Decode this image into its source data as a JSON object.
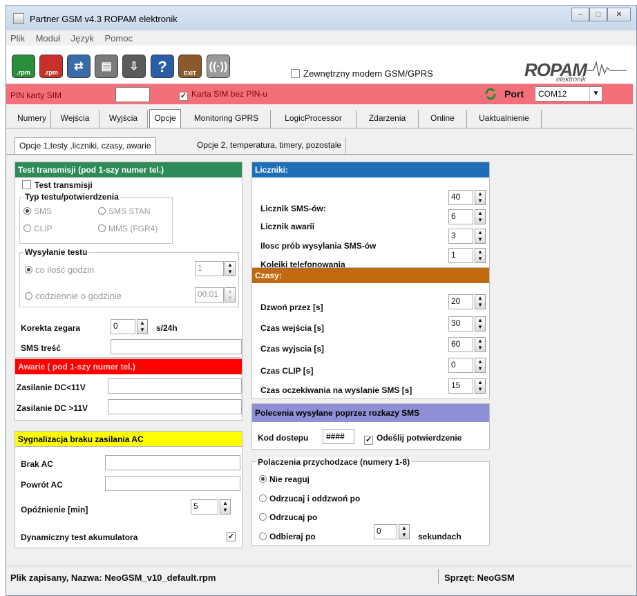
{
  "window": {
    "title": "Partner GSM v4.3 ROPAM elektronik",
    "controls": {
      "minimize": "−",
      "maximize": "□",
      "close": "✕"
    }
  },
  "menu": [
    "Plik",
    "Moduł",
    "Język",
    "Pomoc"
  ],
  "toolbar": {
    "buttons": [
      {
        "icon": "open-rpm-icon",
        "label": ".rpm",
        "color": "#2a8f3a"
      },
      {
        "icon": "save-rpm-icon",
        "label": ".rpm",
        "color": "#c8302a"
      },
      {
        "icon": "read-module-icon",
        "label": "",
        "color": "#3a6aa8"
      },
      {
        "icon": "module-icon",
        "label": "",
        "color": "#7a7a7a"
      },
      {
        "icon": "write-module-icon",
        "label": "",
        "color": "#5a5a5a"
      },
      {
        "icon": "help-icon",
        "label": "?",
        "color": "#2a5da8"
      },
      {
        "icon": "exit-icon",
        "label": "EXIT",
        "color": "#8a5a2a"
      },
      {
        "icon": "wireless-icon",
        "label": "",
        "color": "#9a9a9a"
      }
    ],
    "external_modem_label": "Zewnętrzny modem GSM/GPRS",
    "external_modem_checked": false,
    "logo_text": "ROPAM",
    "logo_sub": "elektronik"
  },
  "pin_bar": {
    "pin_label": "PIN karty SIM",
    "pin_value": "",
    "sim_without_pin_label": "Karta SIM bez PIN-u",
    "sim_without_pin_checked": true,
    "port_label": "Port",
    "port_value": "COM12",
    "bg_color": "#f3707a"
  },
  "tabs": [
    "Numery",
    "Wejścia",
    "Wyjścia",
    "Opcje",
    "Monitoring GPRS",
    "LogicProcessor",
    "Zdarzenia",
    "Online",
    "Uaktualnienie"
  ],
  "active_tab": "Opcje",
  "subtabs": [
    "Opcje 1,testy ,liczniki, czasy, awarie",
    "Opcje 2, temperatura, timery, pozostale"
  ],
  "test_transmisji": {
    "header": "Test transmisji (pod 1-szy numer tel.)",
    "header_color": "#2e8b57",
    "checkbox_label": "Test transmisji",
    "checked": false,
    "type_group_label": "Typ testu/potwierdzenia",
    "types": [
      "SMS",
      "SMS STAN",
      "CLIP",
      "MMS (FGR4)"
    ],
    "selected_type": "SMS",
    "send_group_label": "Wysyłanie testu",
    "every_hours_label": "co ilość godzin",
    "every_hours_value": "1",
    "daily_label": "codziennie o godzinie",
    "daily_value": "00:01",
    "clock_correction_label": "Korekta zegara",
    "clock_correction_value": "0",
    "clock_correction_unit": "s/24h",
    "sms_text_label": "SMS treść",
    "sms_text_value": ""
  },
  "awarie": {
    "header": "Awarie ( pod 1-szy numer tel.)",
    "header_color": "#ff0000",
    "dc_low_label": "Zasilanie DC<11V",
    "dc_high_label": "Zasilanie DC >11V"
  },
  "ac": {
    "header": "Sygnalizacja braku zasilania  AC",
    "header_color": "#ffff00",
    "brak_label": "Brak AC",
    "powrot_label": "Powrót AC",
    "delay_label": "Opóźnienie [min]",
    "delay_value": "5",
    "battery_label": "Dynamiczny test akumulatora",
    "battery_checked": true
  },
  "liczniki": {
    "header": "Liczniki:",
    "header_color": "#1e6fb8",
    "rows": [
      {
        "label": "Licznik SMS-ów:",
        "value": "40"
      },
      {
        "label": "Licznik awarii",
        "value": "6"
      },
      {
        "label": "Ilosc prób wysylania SMS-ów",
        "value": "3"
      },
      {
        "label": "Kolejki telefonowania",
        "value": "1"
      }
    ]
  },
  "czasy": {
    "header": "Czasy:",
    "header_color": "#c0690f",
    "rows": [
      {
        "label": "Dzwoń przez [s]",
        "value": "20"
      },
      {
        "label": "Czas wejścia [s]",
        "value": "30"
      },
      {
        "label": "Czas wyjscia [s]",
        "value": "60"
      },
      {
        "label": "Czas CLIP [s]",
        "value": "0"
      },
      {
        "label": "Czas oczekiwania na wyslanie SMS [s]",
        "value": "15"
      }
    ]
  },
  "polecenia": {
    "header": "Polecenia wysyłane poprzez rozkazy SMS",
    "header_color": "#8f8fd6",
    "code_label": "Kod dostepu",
    "code_value": "####",
    "confirm_label": "Odeślij potwierdzenie",
    "confirm_checked": true
  },
  "polaczenia": {
    "group_label": "Polaczenia przychodzace (numery 1-8)",
    "options": [
      "Nie reaguj",
      "Odrzucaj i oddzwoń po",
      "Odrzucaj po",
      "Odbieraj po"
    ],
    "selected": "Nie reaguj",
    "seconds_value": "0",
    "seconds_label": "sekundach"
  },
  "status": {
    "file_text": "Plik zapisany, Nazwa: NeoGSM_v10_default.rpm",
    "hardware_text": "Sprzęt: NeoGSM"
  }
}
